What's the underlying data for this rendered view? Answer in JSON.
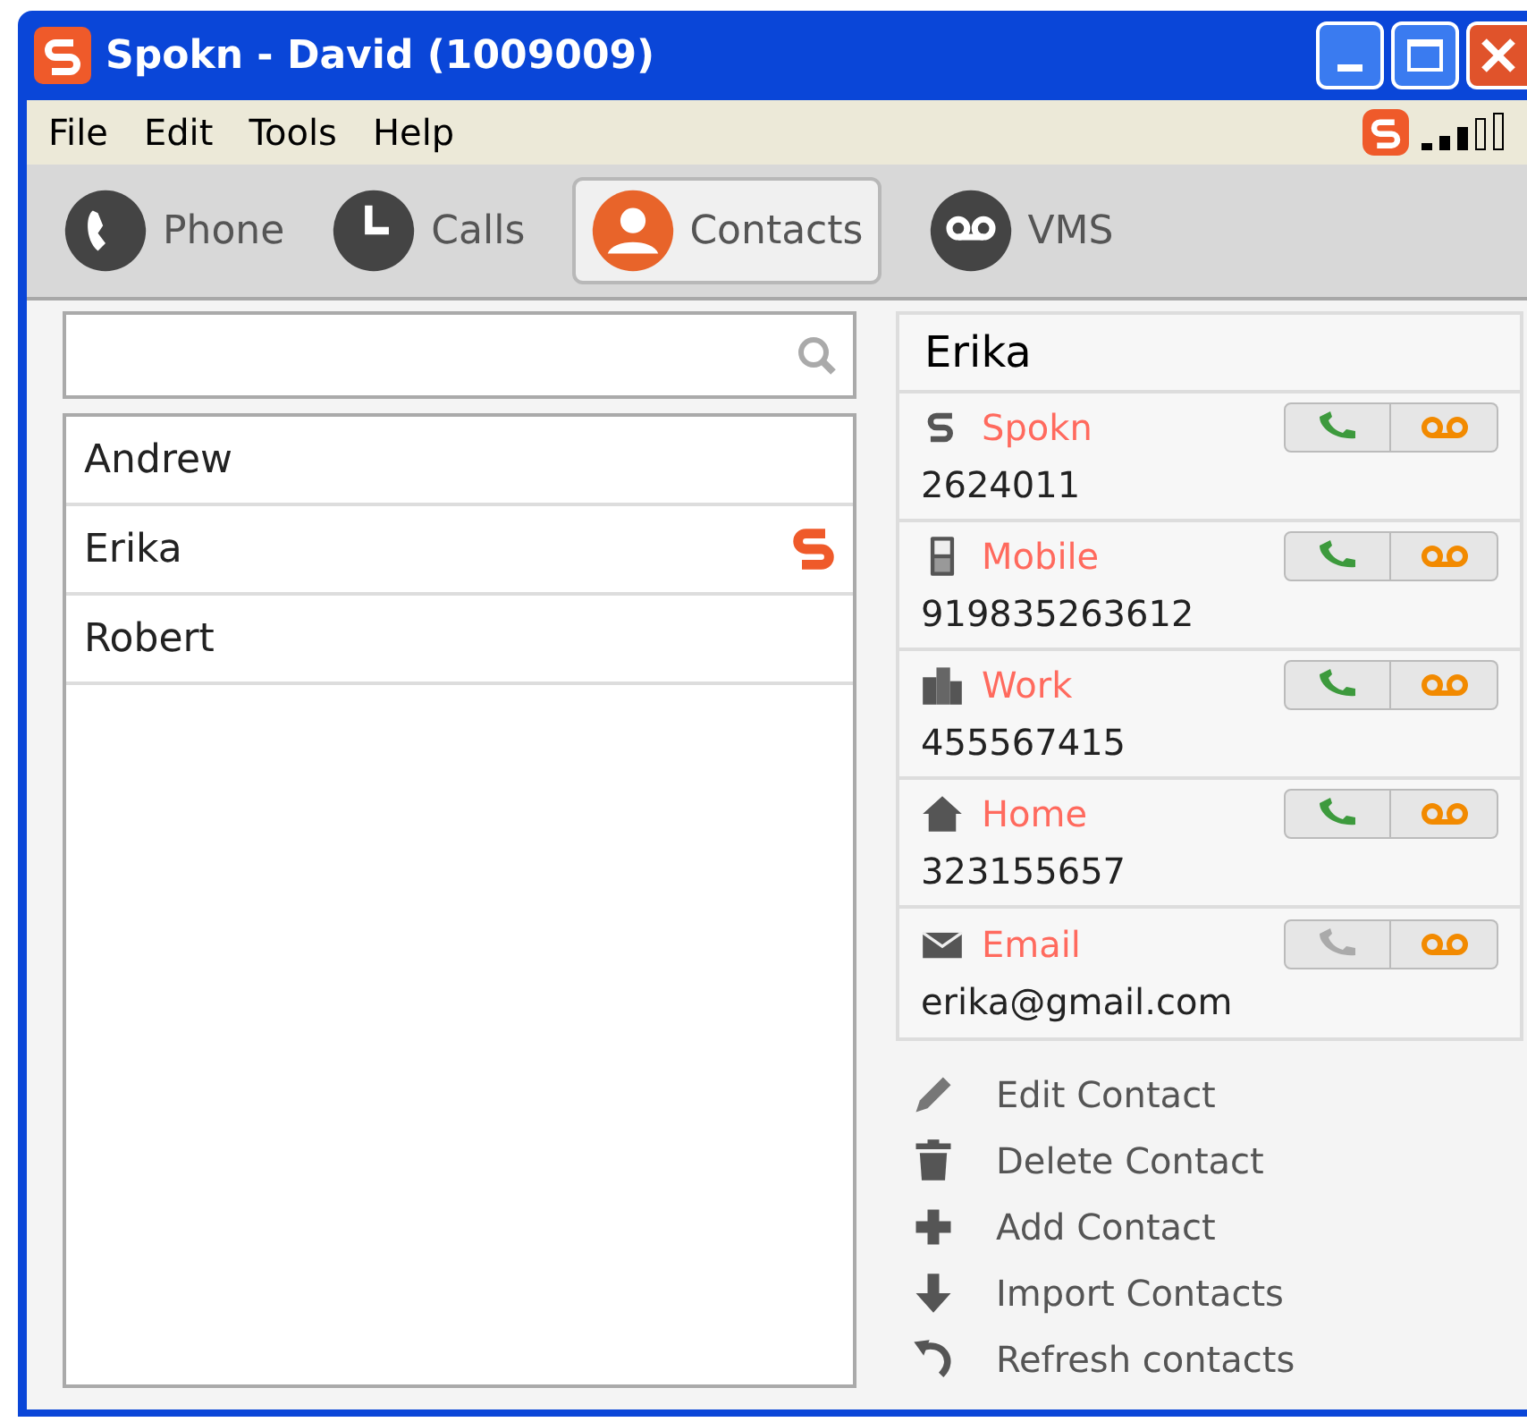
{
  "window": {
    "title": "Spokn - David (1009009)"
  },
  "menu": [
    "File",
    "Edit",
    "Tools",
    "Help"
  ],
  "tabs": [
    {
      "label": "Phone",
      "kind": "phone",
      "selected": false
    },
    {
      "label": "Calls",
      "kind": "calls",
      "selected": false
    },
    {
      "label": "Contacts",
      "kind": "contacts",
      "selected": true
    },
    {
      "label": "VMS",
      "kind": "vms",
      "selected": false
    }
  ],
  "contacts": [
    {
      "name": "Andrew",
      "spokn_user": false
    },
    {
      "name": "Erika",
      "spokn_user": true
    },
    {
      "name": "Robert",
      "spokn_user": false
    }
  ],
  "detail": {
    "name": "Erika",
    "entries": [
      {
        "kind": "spokn",
        "label": "Spokn",
        "value": "2624011",
        "call_enabled": true
      },
      {
        "kind": "mobile",
        "label": "Mobile",
        "value": "919835263612",
        "call_enabled": true
      },
      {
        "kind": "work",
        "label": "Work",
        "value": "455567415",
        "call_enabled": true
      },
      {
        "kind": "home",
        "label": "Home",
        "value": "323155657",
        "call_enabled": true
      },
      {
        "kind": "email",
        "label": "Email",
        "value": "erika@gmail.com",
        "call_enabled": false
      }
    ]
  },
  "actions": [
    {
      "kind": "edit",
      "label": "Edit Contact"
    },
    {
      "kind": "delete",
      "label": "Delete Contact"
    },
    {
      "kind": "add",
      "label": "Add Contact"
    },
    {
      "kind": "import",
      "label": "Import Contacts"
    },
    {
      "kind": "refresh",
      "label": "Refresh contacts"
    }
  ]
}
